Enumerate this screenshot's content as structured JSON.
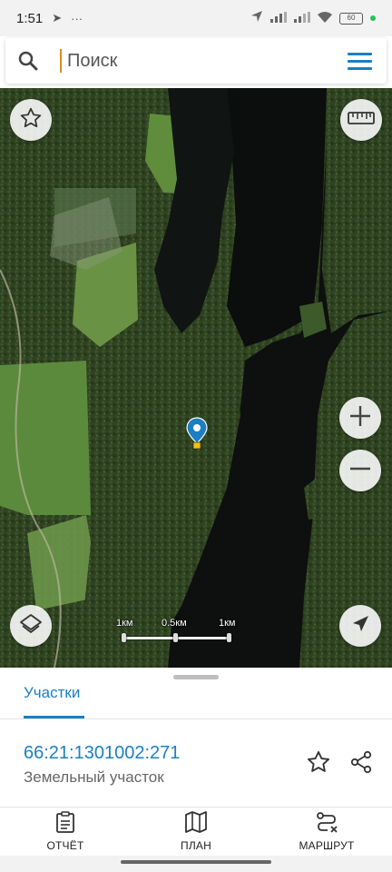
{
  "status_bar": {
    "time": "1:51",
    "telegram_glyph": "➤",
    "more_glyph": "···",
    "battery": "60"
  },
  "search": {
    "placeholder": "Поиск",
    "value": ""
  },
  "map": {
    "scale": {
      "label_0": "1км",
      "label_mid": "0.5км",
      "label_max": "1км"
    },
    "buttons": [
      "favorite-star-icon",
      "ruler-icon",
      "zoom-in-icon",
      "zoom-out-icon",
      "layers-icon",
      "location-arrow-icon"
    ]
  },
  "panel": {
    "tab_label": "Участки",
    "parcel": {
      "number": "66:21:1301002:271",
      "type": "Земельный участок"
    }
  },
  "nav": {
    "report_label": "ОТЧЁТ",
    "plan_label": "ПЛАН",
    "route_label": "МАРШРУТ"
  },
  "colors": {
    "accent": "#1b7fc2",
    "cursor": "#e38a1f",
    "marker": "#1b7fc2",
    "marker_square": "#f5c400"
  }
}
